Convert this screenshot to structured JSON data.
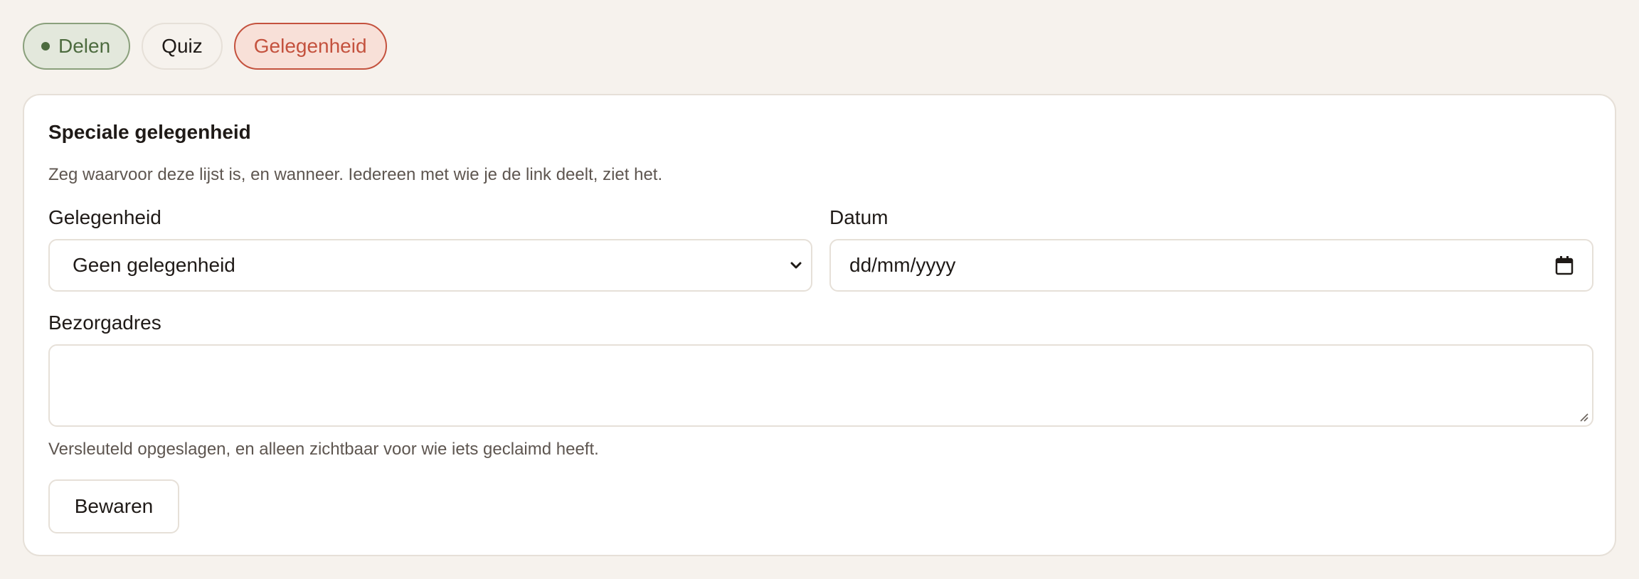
{
  "tabs": [
    {
      "label": "Delen",
      "state": "active-green"
    },
    {
      "label": "Quiz",
      "state": "default"
    },
    {
      "label": "Gelegenheid",
      "state": "selected"
    }
  ],
  "card": {
    "title": "Speciale gelegenheid",
    "description": "Zeg waarvoor deze lijst is, en wanneer. Iedereen met wie je de link deelt, ziet het.",
    "occasion": {
      "label": "Gelegenheid",
      "selected": "Geen gelegenheid",
      "icon": "chevron-down-icon"
    },
    "date": {
      "label": "Datum",
      "placeholder": "dd/mm/yyyy",
      "icon": "calendar-icon"
    },
    "address": {
      "label": "Bezorgadres",
      "value": "",
      "hint": "Versleuteld opgeslagen, en alleen zichtbaar voor wie iets geclaimd heeft."
    },
    "save_label": "Bewaren"
  },
  "colors": {
    "background": "#f6f2ed",
    "green": "#4d6b3f",
    "accent_red": "#c4523e"
  }
}
